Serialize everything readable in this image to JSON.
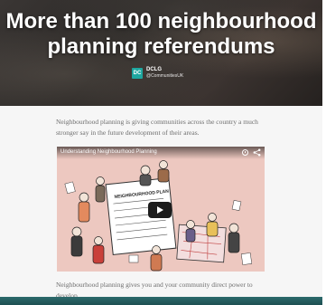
{
  "hero": {
    "title_line1": "More than 100 neighbourhood",
    "title_line2": "planning referendums",
    "account_name": "DCLG",
    "account_handle": "@CommunitiesUK",
    "account_logo_text": "DC"
  },
  "article": {
    "paragraph1": "Neighbourhood planning is giving communities across the country a much stronger say in the future development of their areas.",
    "paragraph2": "Neighbourhood planning gives you and your community direct power to develop"
  },
  "video": {
    "title": "Understanding Neighbourhood Planning",
    "sign_text": "NEIGHBOURHOOD PLAN",
    "icons": [
      "clock-icon",
      "share-icon",
      "play-icon"
    ]
  },
  "colors": {
    "accent": "#1ea7a0",
    "video_bg": "#edc8c0",
    "play_button": "#1c1c1c",
    "bottom_bar": "#2d6b6c"
  }
}
